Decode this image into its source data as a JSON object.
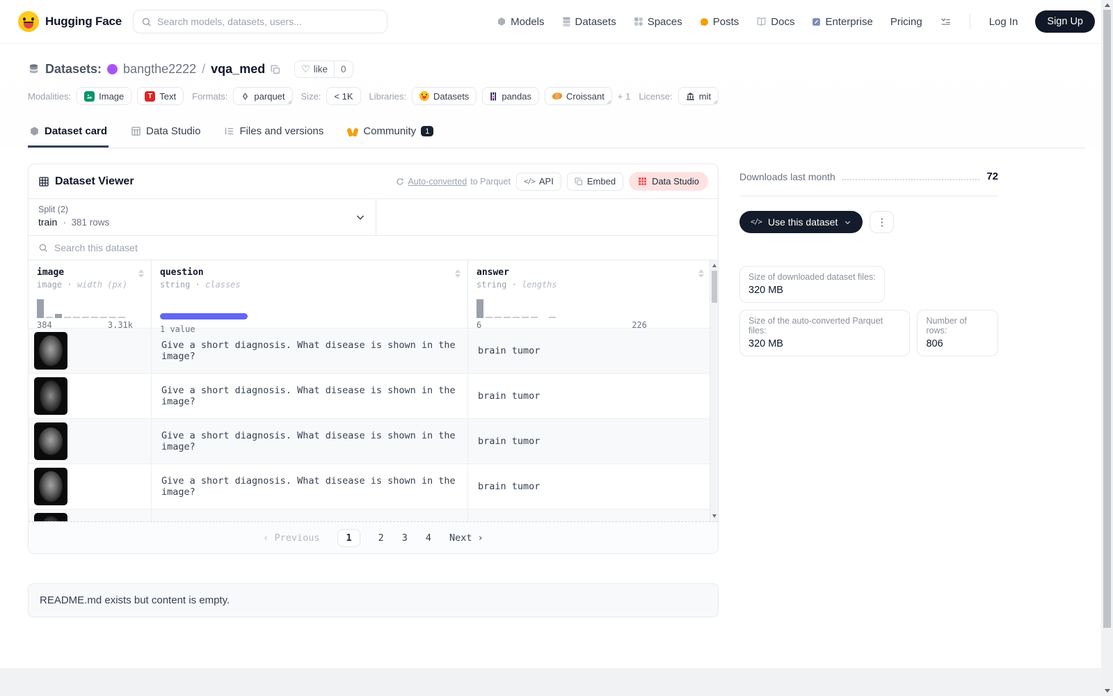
{
  "ui": {
    "dot": "·",
    "heart": "♡",
    "kebab": "⋮",
    "code_glyph": "</>",
    "prev_arrow": "‹",
    "next_arrow": "›"
  },
  "colors": {
    "brand_dark": "#111827",
    "accent_indigo": "#6366f1",
    "data_studio_bg": "#fee2e2",
    "avatar_purple": "#a855f7",
    "posts_orange": "#f59e0b",
    "modality_image_green": "#059669",
    "modality_text_red": "#dc2626"
  },
  "navbar": {
    "brand": "Hugging Face",
    "search_placeholder": "Search models, datasets, users...",
    "items": [
      {
        "label": "Models"
      },
      {
        "label": "Datasets"
      },
      {
        "label": "Spaces"
      },
      {
        "label": "Posts"
      },
      {
        "label": "Docs"
      },
      {
        "label": "Enterprise"
      },
      {
        "label": "Pricing"
      }
    ],
    "login_label": "Log In",
    "signup_label": "Sign Up"
  },
  "header": {
    "type_label": "Datasets:",
    "owner": "bangthe2222",
    "separator": "/",
    "name": "vqa_med",
    "like_label": "like",
    "like_count": "0",
    "meta": {
      "modalities_label": "Modalities:",
      "modality_image": "Image",
      "modality_text": "Text",
      "formats_label": "Formats:",
      "format_parquet": "parquet",
      "size_label": "Size:",
      "size_value": "< 1K",
      "libraries_label": "Libraries:",
      "lib_datasets": "Datasets",
      "lib_pandas": "pandas",
      "lib_croissant": "Croissant",
      "libraries_more": "+ 1",
      "license_label": "License:",
      "license_value": "mit"
    },
    "tabs": [
      {
        "label": "Dataset card"
      },
      {
        "label": "Data Studio"
      },
      {
        "label": "Files and versions"
      },
      {
        "label": "Community",
        "badge": "1"
      }
    ]
  },
  "viewer": {
    "title": "Dataset Viewer",
    "auto_converted_link": "Auto-converted",
    "auto_converted_rest": "to Parquet",
    "api_label": "API",
    "embed_label": "Embed",
    "data_studio_label": "Data Studio",
    "split_label": "Split (2)",
    "split_value": "train",
    "split_rows": "381 rows",
    "search_placeholder": "Search this dataset",
    "columns": [
      {
        "name": "image",
        "type": "image",
        "subtype": "width (px)",
        "hist_min": "384",
        "hist_max": "3.31k"
      },
      {
        "name": "question",
        "type": "string",
        "subtype": "classes",
        "hist_note": "1 value"
      },
      {
        "name": "answer",
        "type": "string",
        "subtype": "lengths",
        "hist_min": "6",
        "hist_max": "226"
      }
    ],
    "rows": [
      {
        "question": "Give a short diagnosis. What disease is shown in the image?",
        "answer": "brain tumor"
      },
      {
        "question": "Give a short diagnosis. What disease is shown in the image?",
        "answer": "brain tumor"
      },
      {
        "question": "Give a short diagnosis. What disease is shown in the image?",
        "answer": "brain tumor"
      },
      {
        "question": "Give a short diagnosis. What disease is shown in the image?",
        "answer": "brain tumor"
      }
    ],
    "pagination": {
      "previous": "Previous",
      "pages": [
        "1",
        "2",
        "3",
        "4"
      ],
      "current": "1",
      "next": "Next"
    }
  },
  "readme": {
    "text": "README.md exists but content is empty."
  },
  "sidebar": {
    "downloads_label": "Downloads last month",
    "downloads_value": "72",
    "use_dataset_label": "Use this dataset",
    "stats": [
      {
        "label": "Size of downloaded dataset files:",
        "value": "320 MB"
      },
      {
        "label": "Size of the auto-converted Parquet files:",
        "value": "320 MB"
      },
      {
        "label": "Number of rows:",
        "value": "806"
      }
    ]
  }
}
